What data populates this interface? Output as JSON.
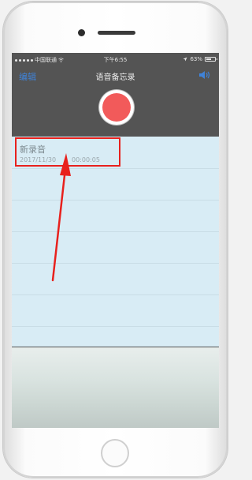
{
  "status_bar": {
    "carrier": "中国联通",
    "time": "下午6:55",
    "battery": "63%",
    "battery_level": 0.63
  },
  "nav": {
    "edit_label": "编辑",
    "title": "语音备忘录"
  },
  "recordings": [
    {
      "name": "新录音",
      "date": "2017/11/30",
      "duration": "00:00:05"
    }
  ],
  "colors": {
    "accent": "#3f83d9",
    "record": "#f25a5a",
    "list_bg": "#d8ecf5",
    "annotation": "#e8211d"
  },
  "icons": [
    "wifi-icon",
    "location-icon",
    "battery-icon",
    "speaker-icon",
    "record-icon"
  ]
}
